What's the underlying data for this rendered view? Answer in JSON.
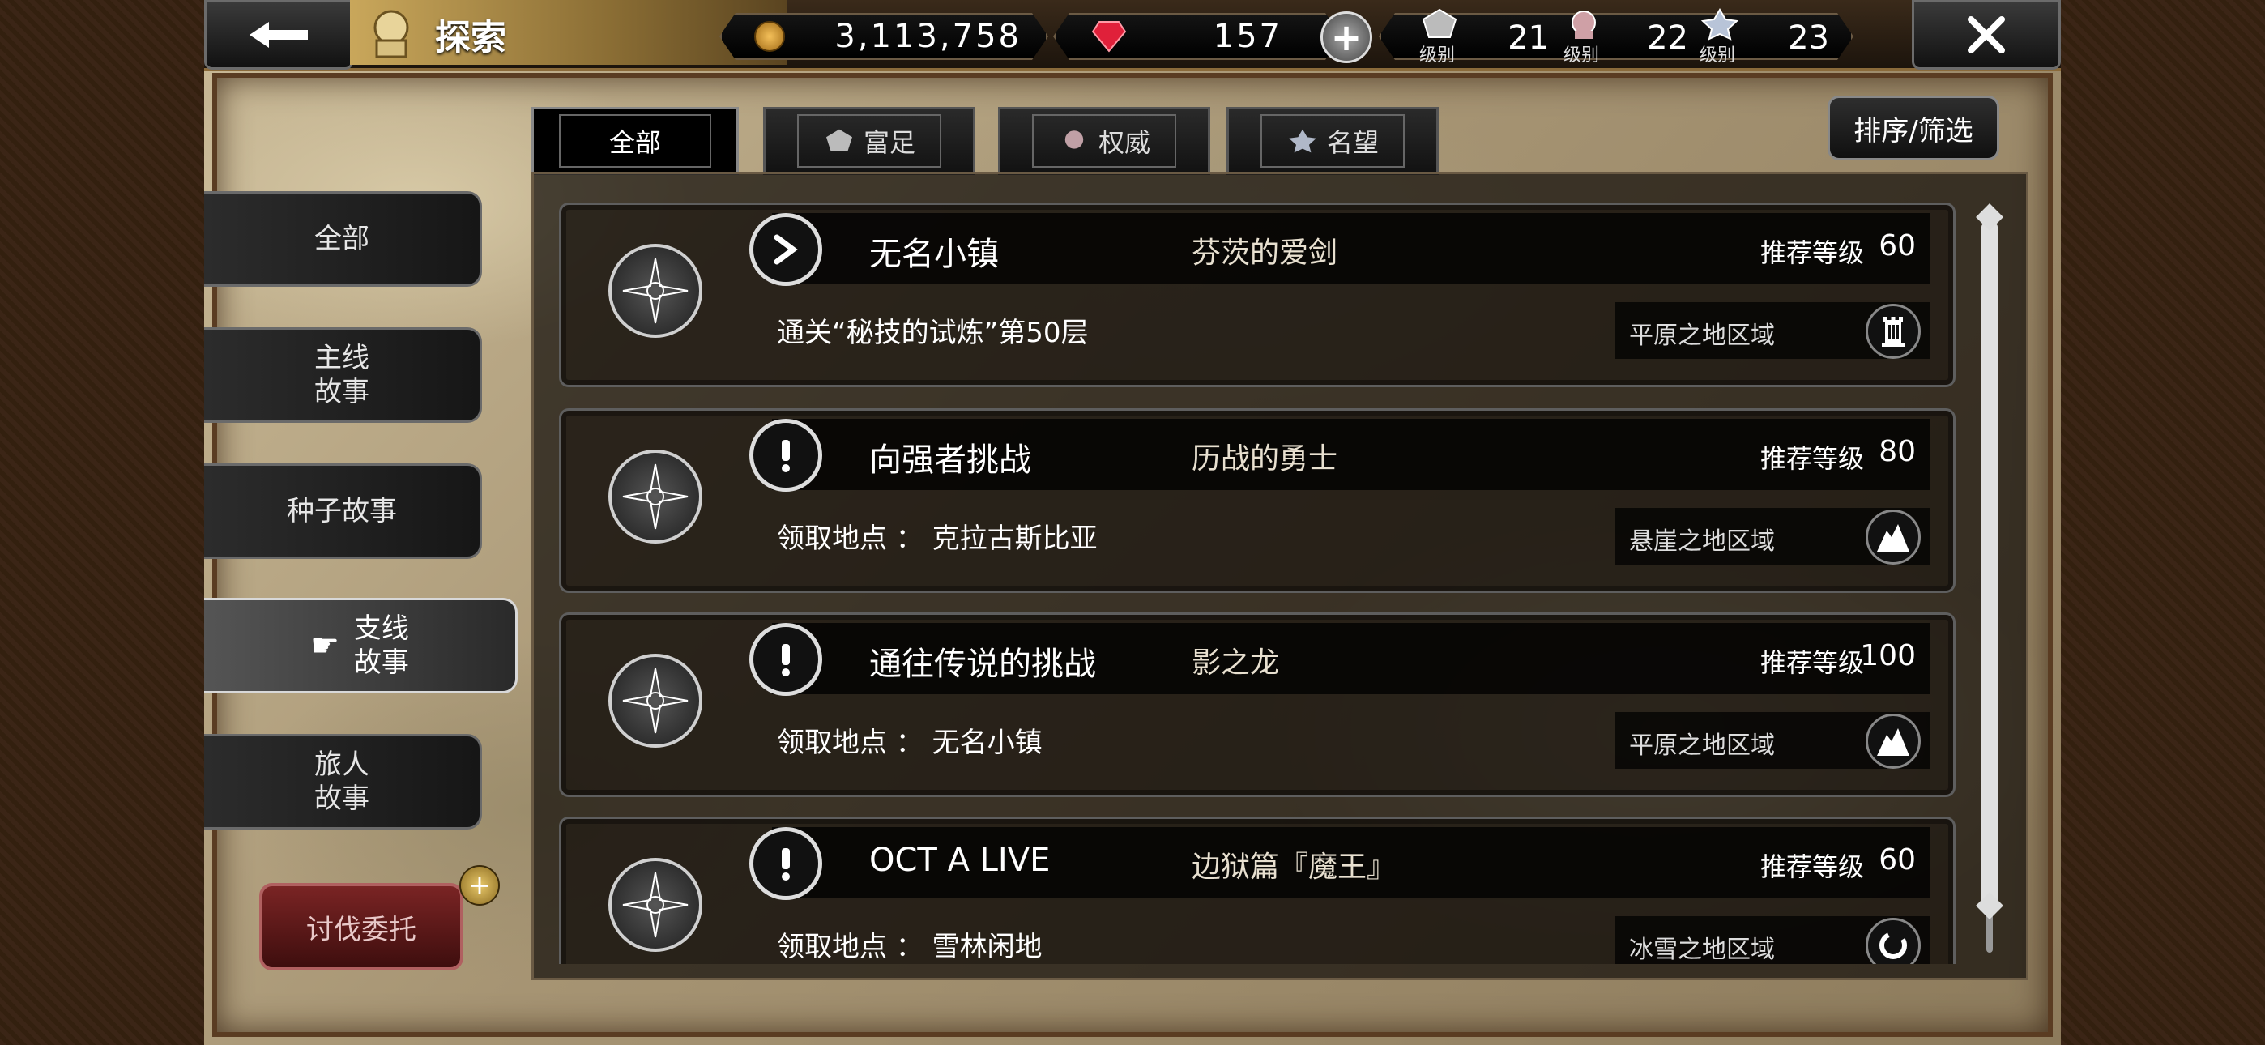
{
  "header": {
    "title": "探索",
    "coins": "3,113,758",
    "gems": "157",
    "levels": [
      {
        "tag": "级别",
        "value": "21",
        "icon": "wealth-crest-icon"
      },
      {
        "tag": "级别",
        "value": "22",
        "icon": "power-crest-icon"
      },
      {
        "tag": "级别",
        "value": "23",
        "icon": "fame-crest-icon"
      }
    ]
  },
  "tabs": [
    {
      "label": "全部"
    },
    {
      "label": "富足"
    },
    {
      "label": "权威"
    },
    {
      "label": "名望"
    }
  ],
  "sort_label": "排序/筛选",
  "nav": [
    {
      "line1": "全部",
      "line2": ""
    },
    {
      "line1": "主线",
      "line2": "故事"
    },
    {
      "line1": "种子故事",
      "line2": ""
    },
    {
      "line1": "支线",
      "line2": "故事"
    },
    {
      "line1": "旅人",
      "line2": "故事"
    }
  ],
  "commission_label": "讨伐委托",
  "quests": [
    {
      "name": "无名小镇",
      "subtitle": "芬茨的爱剑",
      "level_label": "推荐等级",
      "level": "60",
      "detail": "通关“秘技的试炼”第50层",
      "region": "平原之地区域",
      "type_icon": "arrow-icon",
      "region_icon": "tower-icon"
    },
    {
      "name": "向强者挑战",
      "subtitle": "历战的勇士",
      "level_label": "推荐等级",
      "level": "80",
      "detail": "领取地点 ： 克拉古斯比亚",
      "region": "悬崖之地区域",
      "type_icon": "exclamation-icon",
      "region_icon": "mountain-icon"
    },
    {
      "name": "通往传说的挑战",
      "subtitle": "影之龙",
      "level_label": "推荐等级",
      "level": "100",
      "detail": "领取地点 ： 无名小镇",
      "region": "平原之地区域",
      "type_icon": "exclamation-icon",
      "region_icon": "mountain-icon"
    },
    {
      "name": "OCT A LIVE",
      "subtitle": "边狱篇『魔王』",
      "level_label": "推荐等级",
      "level": "60",
      "detail": "领取地点 ： 雪林闲地",
      "region": "冰雪之地区域",
      "type_icon": "exclamation-icon",
      "region_icon": "swirl-icon"
    }
  ]
}
